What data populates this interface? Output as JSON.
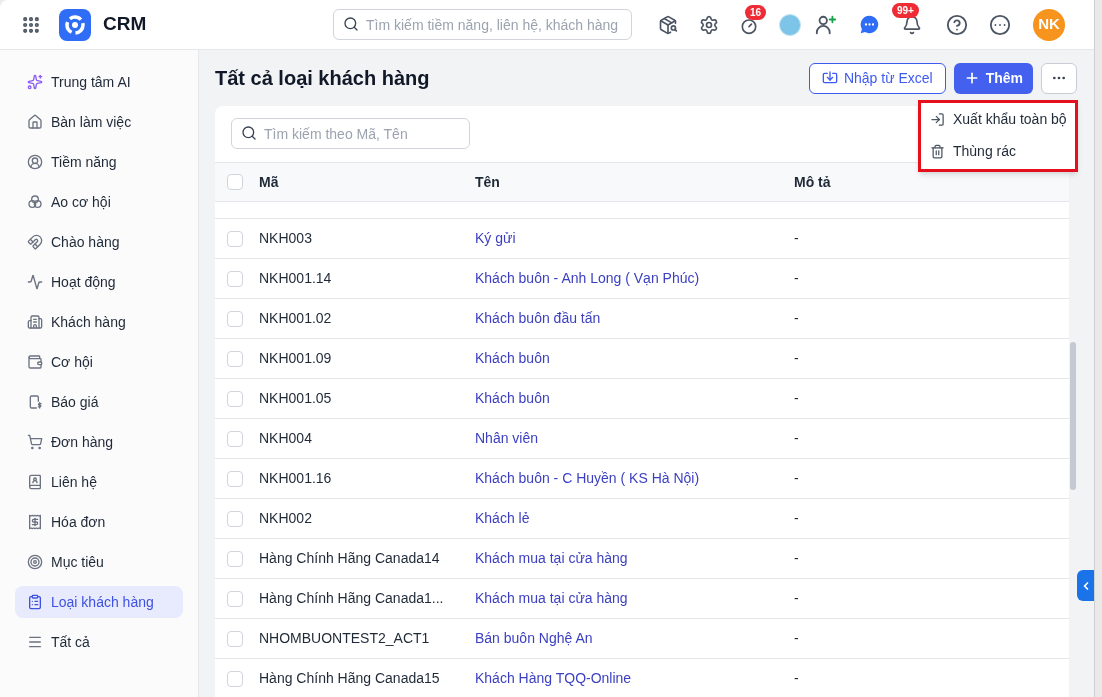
{
  "app": {
    "title": "CRM"
  },
  "topbar": {
    "search": {
      "placeholder": "Tìm kiếm tiềm năng, liên hệ, khách hàng"
    },
    "timer_badge": "16",
    "notification_badge": "99+",
    "user_initials": "NK"
  },
  "sidebar": {
    "items": [
      {
        "label": "Trung tâm AI",
        "selected": false
      },
      {
        "label": "Bàn làm việc",
        "selected": false
      },
      {
        "label": "Tiềm năng",
        "selected": false
      },
      {
        "label": "Ao cơ hội",
        "selected": false
      },
      {
        "label": "Chào hàng",
        "selected": false
      },
      {
        "label": "Hoạt động",
        "selected": false
      },
      {
        "label": "Khách hàng",
        "selected": false
      },
      {
        "label": "Cơ hội",
        "selected": false
      },
      {
        "label": "Báo giá",
        "selected": false
      },
      {
        "label": "Đơn hàng",
        "selected": false
      },
      {
        "label": "Liên hệ",
        "selected": false
      },
      {
        "label": "Hóa đơn",
        "selected": false
      },
      {
        "label": "Mục tiêu",
        "selected": false
      },
      {
        "label": "Loại khách hàng",
        "selected": true
      },
      {
        "label": "Tất cả",
        "selected": false
      }
    ]
  },
  "page": {
    "title": "Tất cả loại khách hàng",
    "actions": [
      {
        "label": "Nhập từ Excel",
        "kind": "outline"
      },
      {
        "label": "Thêm",
        "kind": "primary"
      }
    ],
    "more_menu": {
      "open": true,
      "items": [
        "Xuất khẩu toàn bộ",
        "Thùng rác"
      ]
    }
  },
  "table": {
    "search": {
      "placeholder": "Tìm kiếm theo Mã, Tên"
    },
    "header_checked": false,
    "columns": [
      "Mã",
      "Tên",
      "Mô tả"
    ],
    "rows": [
      {
        "code": "NKH003",
        "name": "Ký gửi",
        "description": "-",
        "checked": false
      },
      {
        "code": "NKH001.14",
        "name": "Khách buôn - Anh Long ( Vạn Phúc)",
        "description": "-",
        "checked": false
      },
      {
        "code": "NKH001.02",
        "name": "Khách buôn đầu tấn",
        "description": "-",
        "checked": false
      },
      {
        "code": "NKH001.09",
        "name": "Khách buôn",
        "description": "-",
        "checked": false
      },
      {
        "code": "NKH001.05",
        "name": "Khách buôn",
        "description": "-",
        "checked": false
      },
      {
        "code": "NKH004",
        "name": "Nhân viên",
        "description": "-",
        "checked": false
      },
      {
        "code": "NKH001.16",
        "name": "Khách buôn - C Huyền ( KS Hà Nội)",
        "description": "-",
        "checked": false
      },
      {
        "code": "NKH002",
        "name": "Khách lẻ",
        "description": "-",
        "checked": false
      },
      {
        "code": "Hàng Chính Hãng Canada14",
        "name": "Khách mua tại cửa hàng",
        "description": "-",
        "checked": false
      },
      {
        "code": "Hàng Chính Hãng Canada1...",
        "name": "Khách mua tại cửa hàng",
        "description": "-",
        "checked": false
      },
      {
        "code": "NHOMBUONTEST2_ACT1",
        "name": "Bán buôn Nghệ An",
        "description": "-",
        "checked": false
      },
      {
        "code": "Hàng Chính Hãng Canada15",
        "name": "Khách Hàng TQQ-Online",
        "description": "-",
        "checked": false
      }
    ]
  }
}
